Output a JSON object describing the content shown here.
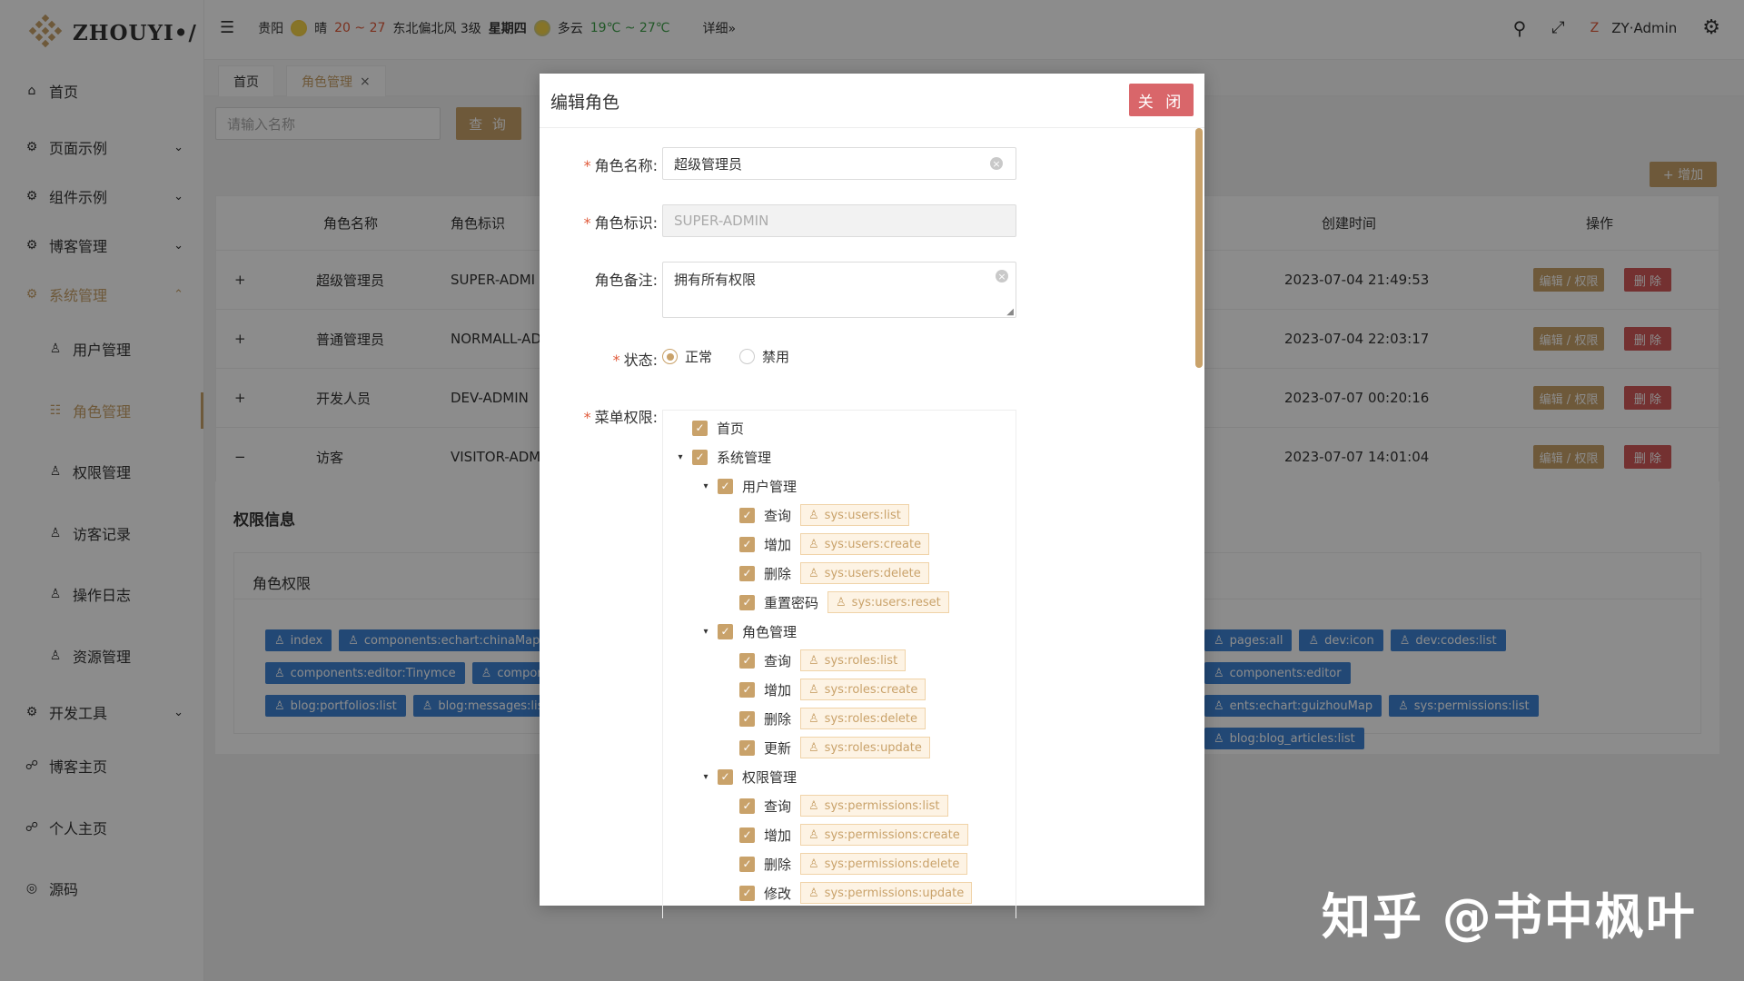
{
  "app": {
    "logo": "ZHOUYI•/"
  },
  "sidebar": {
    "items": [
      {
        "icon": "home-icon",
        "glyph": "⌂",
        "label": "首页"
      },
      {
        "icon": "gear-icon",
        "glyph": "⚙",
        "label": "页面示例",
        "arrow": "⌄"
      },
      {
        "icon": "gear-icon",
        "glyph": "⚙",
        "label": "组件示例",
        "arrow": "⌄"
      },
      {
        "icon": "gear-icon",
        "glyph": "⚙",
        "label": "博客管理",
        "arrow": "⌄"
      },
      {
        "icon": "gear-icon",
        "glyph": "⚙",
        "label": "系统管理",
        "arrow": "⌃"
      },
      {
        "icon": "user-icon",
        "glyph": "♙",
        "label": "用户管理"
      },
      {
        "icon": "grid-icon",
        "glyph": "☷",
        "label": "角色管理"
      },
      {
        "icon": "user-icon",
        "glyph": "♙",
        "label": "权限管理"
      },
      {
        "icon": "user-icon",
        "glyph": "♙",
        "label": "访客记录"
      },
      {
        "icon": "user-icon",
        "glyph": "♙",
        "label": "操作日志"
      },
      {
        "icon": "user-icon",
        "glyph": "♙",
        "label": "资源管理"
      },
      {
        "icon": "gear-icon",
        "glyph": "⚙",
        "label": "开发工具",
        "arrow": "⌄"
      },
      {
        "icon": "link-icon",
        "glyph": "☍",
        "label": "博客主页"
      },
      {
        "icon": "link-icon",
        "glyph": "☍",
        "label": "个人主页"
      },
      {
        "icon": "github-icon",
        "glyph": "◎",
        "label": "源码"
      }
    ]
  },
  "header": {
    "menu_icon": "☰",
    "city": "贵阳",
    "w1": "晴",
    "t1": "20 ~ 27",
    "wind": "东北偏北风 3级",
    "day": "星期四",
    "w2": "多云",
    "t2": "19℃ ~ 27℃",
    "detail": "详细»",
    "user": "ZY·Admin",
    "search": "⚲",
    "full": "⤢",
    "gear": "⚙",
    "z": "Z"
  },
  "tabs": {
    "home": "首页",
    "role": "角色管理",
    "close": "×"
  },
  "toolbar": {
    "search_placeholder": "请输入名称",
    "query": "查 询",
    "add": "+ 增加"
  },
  "table": {
    "headers": {
      "name": "角色名称",
      "code": "角色标识",
      "created": "创建时间",
      "ops": "操作"
    },
    "rows": [
      {
        "exp": "+",
        "name": "超级管理员",
        "code": "SUPER-ADMI",
        "time": "2023-07-04 21:49:53"
      },
      {
        "exp": "+",
        "name": "普通管理员",
        "code": "NORMALL-AD",
        "time": "2023-07-04 22:03:17"
      },
      {
        "exp": "+",
        "name": "开发人员",
        "code": "DEV-ADMIN",
        "time": "2023-07-07 00:20:16"
      },
      {
        "exp": "−",
        "name": "访客",
        "code": "VISITOR-ADM",
        "time": "2023-07-07 14:01:04"
      }
    ],
    "edit": "编辑 / 权限",
    "del": "删 除"
  },
  "perm": {
    "title": "权限信息",
    "sub": "角色权限",
    "tags_row1_left": [
      "index",
      "components:echart:chinaMap"
    ],
    "tags_row1_right": [
      "pages:all",
      "dev:icon",
      "dev:codes:list",
      "components:editor"
    ],
    "tags_row2_left": [
      "components:editor:Tinymce",
      "compone"
    ],
    "tags_row2_right": [
      "ents:echart:guizhouMap",
      "sys:permissions:list",
      "blog:blog_articles:list"
    ],
    "tags_row3_left": [
      "blog:portfolios:list",
      "blog:messages:list"
    ]
  },
  "modal": {
    "title": "编辑角色",
    "close": "关 闭",
    "f_name": "角色名称",
    "f_name_val": "超级管理员",
    "f_code": "角色标识",
    "f_code_ph": "SUPER-ADMIN",
    "f_note": "角色备注",
    "f_note_val": "拥有所有权限",
    "f_status": "状态",
    "opt_on": "正常",
    "opt_off": "禁用",
    "f_menu": "菜单权限",
    "colon": ":",
    "star": "*"
  },
  "tree": [
    {
      "label": "首页",
      "level": 1
    },
    {
      "label": "系统管理",
      "level": 1,
      "caret": "▾"
    },
    {
      "label": "用户管理",
      "level": 2,
      "caret": "▾"
    },
    {
      "label": "查询",
      "level": 3,
      "tag": "sys:users:list"
    },
    {
      "label": "增加",
      "level": 3,
      "tag": "sys:users:create"
    },
    {
      "label": "删除",
      "level": 3,
      "tag": "sys:users:delete"
    },
    {
      "label": "重置密码",
      "level": 3,
      "tag": "sys:users:reset"
    },
    {
      "label": "角色管理",
      "level": 2,
      "caret": "▾"
    },
    {
      "label": "查询",
      "level": 3,
      "tag": "sys:roles:list"
    },
    {
      "label": "增加",
      "level": 3,
      "tag": "sys:roles:create"
    },
    {
      "label": "删除",
      "level": 3,
      "tag": "sys:roles:delete"
    },
    {
      "label": "更新",
      "level": 3,
      "tag": "sys:roles:update"
    },
    {
      "label": "权限管理",
      "level": 2,
      "caret": "▾"
    },
    {
      "label": "查询",
      "level": 3,
      "tag": "sys:permissions:list"
    },
    {
      "label": "增加",
      "level": 3,
      "tag": "sys:permissions:create"
    },
    {
      "label": "删除",
      "level": 3,
      "tag": "sys:permissions:delete"
    },
    {
      "label": "修改",
      "level": 3,
      "tag": "sys:permissions:update"
    }
  ],
  "watermark": "知乎 @书中枫叶",
  "colors": {
    "accent": "#c9a26a",
    "danger": "#d35a5a",
    "tag_blue": "#3f84d6"
  }
}
